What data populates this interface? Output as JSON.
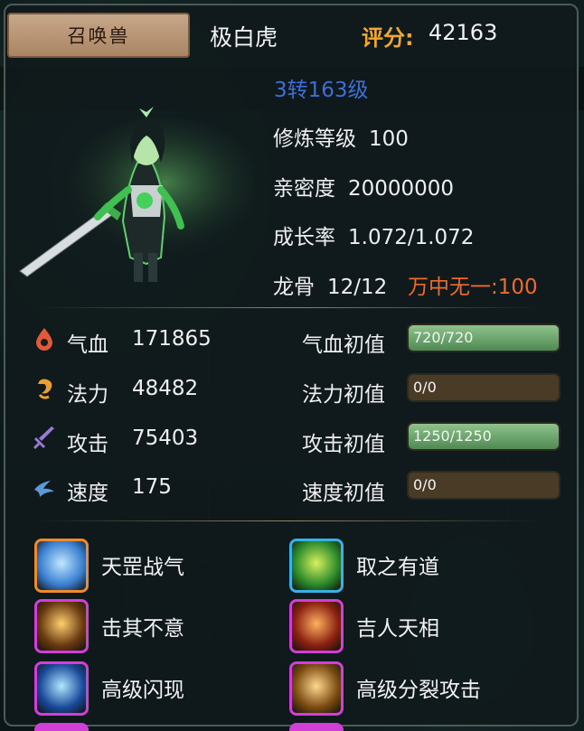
{
  "header": {
    "tab_label": "召唤兽",
    "pet_name": "极白虎",
    "score_label": "评分:",
    "score_value": "42163"
  },
  "profile": {
    "level_text": "3转163级",
    "rows": [
      {
        "label": "修炼等级",
        "value": "100"
      },
      {
        "label": "亲密度",
        "value": "20000000"
      },
      {
        "label": "成长率",
        "value": "1.072/1.072"
      },
      {
        "label": "龙骨",
        "value": "12/12"
      }
    ],
    "special_text": "万中无一:100"
  },
  "stats": [
    {
      "icon": "blood-drop-icon",
      "name": "气血",
      "value": "171865",
      "init_label": "气血初值",
      "init_text": "720/720",
      "fill": 1.0
    },
    {
      "icon": "mana-swirl-icon",
      "name": "法力",
      "value": "48482",
      "init_label": "法力初值",
      "init_text": "0/0",
      "fill": 0.0
    },
    {
      "icon": "sword-icon",
      "name": "攻击",
      "value": "75403",
      "init_label": "攻击初值",
      "init_text": "1250/1250",
      "fill": 1.0
    },
    {
      "icon": "wind-icon",
      "name": "速度",
      "value": "175",
      "init_label": "速度初值",
      "init_text": "0/0",
      "fill": 0.0
    }
  ],
  "skills": [
    {
      "name": "天罡战气",
      "icon": "blue-vortex-skill-icon",
      "frame": "#f08a2a",
      "c1": "#3a7fd0",
      "c2": "#bfe8ff"
    },
    {
      "name": "取之有道",
      "icon": "green-pillar-skill-icon",
      "frame": "#3ab0e8",
      "c1": "#2a8a2a",
      "c2": "#d8f060"
    },
    {
      "name": "击其不意",
      "icon": "golden-slash-skill-icon",
      "frame": "#d040d8",
      "c1": "#6a3a10",
      "c2": "#ffd070"
    },
    {
      "name": "吉人天相",
      "icon": "red-figure-skill-icon",
      "frame": "#d040d8",
      "c1": "#8a2010",
      "c2": "#ffb060"
    },
    {
      "name": "高级闪现",
      "icon": "blue-flash-skill-icon",
      "frame": "#d040d8",
      "c1": "#1a4a9a",
      "c2": "#b0e8ff"
    },
    {
      "name": "高级分裂攻击",
      "icon": "golden-split-skill-icon",
      "frame": "#d040d8",
      "c1": "#7a4a10",
      "c2": "#ffd890"
    }
  ]
}
